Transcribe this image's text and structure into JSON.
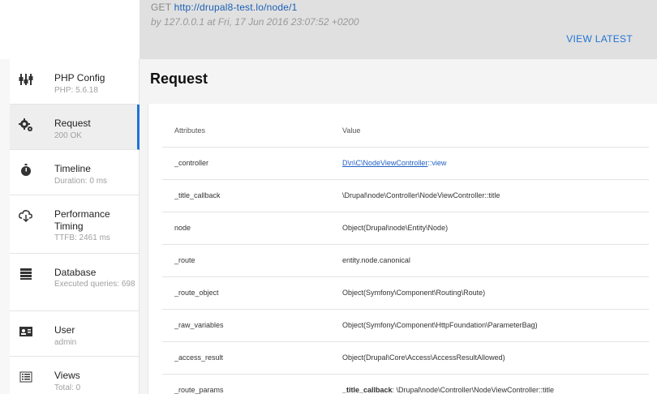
{
  "header": {
    "method": "GET",
    "url": "http://drupal8-test.lo/node/1",
    "meta": "by 127.0.0.1 at Fri, 17 Jun 2016 23:07:52 +0200",
    "view_latest": "VIEW LATEST"
  },
  "sidebar": {
    "items": [
      {
        "title": "PHP Config",
        "sub": "PHP: 5.6.18",
        "icon": "php-config-icon"
      },
      {
        "title": "Request",
        "sub": "200 OK",
        "icon": "gears-icon"
      },
      {
        "title": "Timeline",
        "sub": "Duration: 0 ms",
        "icon": "stopwatch-icon"
      },
      {
        "title": "Performance Timing",
        "sub": "TTFB: 2461 ms",
        "icon": "cloud-download-icon"
      },
      {
        "title": "Database",
        "sub": "Executed queries: 698",
        "icon": "database-icon"
      },
      {
        "title": "User",
        "sub": "admin",
        "icon": "user-card-icon"
      },
      {
        "title": "Views",
        "sub": "Total: 0",
        "icon": "list-icon"
      }
    ]
  },
  "main": {
    "title": "Request",
    "table": {
      "headers": [
        "Attributes",
        "Value"
      ],
      "rows": [
        {
          "key": "_controller",
          "value_link": "D\\n\\C\\NodeViewController",
          "value_rest": "::view"
        },
        {
          "key": "_title_callback",
          "value": "\\Drupal\\node\\Controller\\NodeViewController::title"
        },
        {
          "key": "node",
          "value": "Object(Drupal\\node\\Entity\\Node)"
        },
        {
          "key": "_route",
          "value": "entity.node.canonical"
        },
        {
          "key": "_route_object",
          "value": "Object(Symfony\\Component\\Routing\\Route)"
        },
        {
          "key": "_raw_variables",
          "value": "Object(Symfony\\Component\\HttpFoundation\\ParameterBag)"
        },
        {
          "key": "_access_result",
          "value": "Object(Drupal\\Core\\Access\\AccessResultAllowed)"
        },
        {
          "key": "_route_params",
          "value_bold": "_title_callback",
          "value": ": \\Drupal\\node\\Controller\\NodeViewController::title"
        }
      ]
    }
  }
}
